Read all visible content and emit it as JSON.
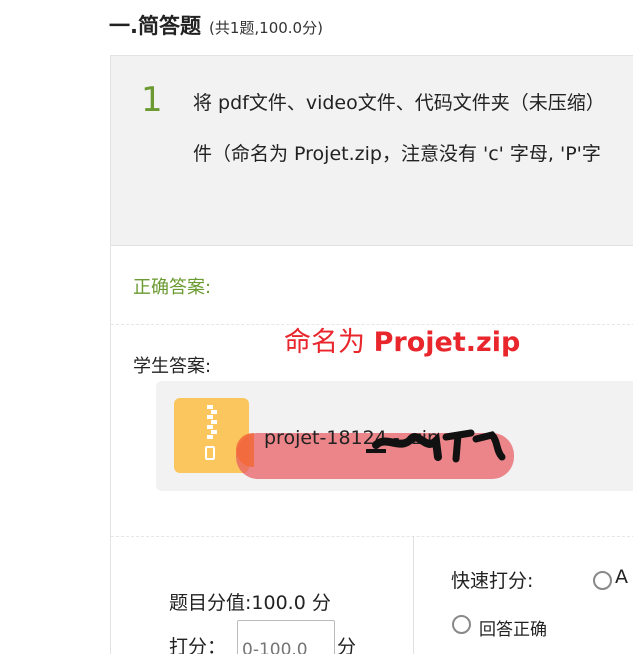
{
  "section": {
    "title": "一.简答题",
    "subtitle": "(共1题,100.0分)"
  },
  "question": {
    "number": "1",
    "line1": "将 pdf文件、video文件、代码文件夹（未压缩）",
    "line2": "件（命名为 Projet.zip，注意没有 'c' 字母, 'P'字"
  },
  "correct_answer_label": "正确答案:",
  "annotation": {
    "prefix": "命名为 ",
    "filename": "Projet.zip",
    "color": "#e8262c"
  },
  "student_answer_label": "学生答案:",
  "attachment": {
    "icon": "zip-file-icon",
    "filename": "projet-18124   -    .zip"
  },
  "grading": {
    "score_value_label": "题目分值:",
    "score_value": "100.0 分",
    "score_label": "打分：",
    "score_placeholder": "0-100.0",
    "score_unit": "分",
    "quick_label": "快速打分:",
    "option_a": "A",
    "option_correct": "回答正确"
  },
  "colors": {
    "accent_green": "#6a9a30",
    "zip_icon": "#fbc65e",
    "highlight": "#e85a5f"
  }
}
